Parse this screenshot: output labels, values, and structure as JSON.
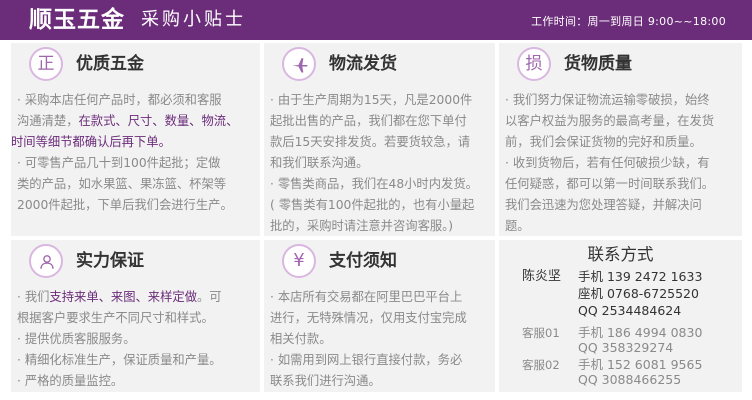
{
  "header": {
    "brand": "顺玉五金",
    "tagline": "采购小贴士",
    "hours": "工作时间：周一到周日  9:00~~18:00"
  },
  "colors": {
    "header_bg": "#6b2c7a",
    "highlight": "#6b2c7a",
    "panel_bg": "#f2f2f2",
    "icon_ring": "#d9b7e0"
  },
  "panels": {
    "quality_hardware": {
      "icon": "zheng-character-icon",
      "icon_char": "正",
      "title": "优质五金",
      "lines": [
        [
          "· 采购本店任何产品时，都必须和客服",
          "",
          ""
        ],
        [
          "沟通清楚，",
          "在款式、尺寸、数量、物流、",
          ""
        ],
        [
          "",
          "时间等细节都确认后再下单。",
          ""
        ],
        [
          "· 可零售产品几十到100件起批；定做",
          "",
          ""
        ],
        [
          "类的产品，如水果篮、果冻篮、杯架等",
          "",
          ""
        ],
        [
          "2000件起批，下单后我们会进行生产。",
          "",
          ""
        ]
      ]
    },
    "logistics": {
      "icon": "airplane-icon",
      "title": "物流发货",
      "lines": [
        "· 由于生产周期为15天，凡是2000件",
        "起批出售的产品，我们都在您下单付",
        "款后15天安排发货。若要货较急，请",
        "和我们联系沟通。",
        "· 零售类商品，我们在48小时内发货。",
        "( 零售类有100件起批的，也有小量起",
        "批的，采购时请注意并咨询客服。)"
      ]
    },
    "goods_quality": {
      "icon": "sun-character-icon",
      "icon_char": "损",
      "title": "货物质量",
      "lines": [
        "· 我们努力保证物流运输零破损，始终",
        "以客户权益为服务的最高考量，在发货",
        "前，我们会保证货物的完好和质量。",
        "· 收到货物后，若有任何破损少缺，有",
        "任何疑惑，都可以第一时间联系我们。",
        "我们会迅速为您处理答疑，并解决问",
        "题。"
      ]
    },
    "strength": {
      "icon": "person-icon",
      "title": "实力保证",
      "lines": [
        [
          "· 我们",
          "支持来单、来图、来样定做",
          "。可"
        ],
        [
          "根据客户要求生产不同尺寸和样式。",
          "",
          ""
        ],
        [
          "· 提供优质客服服务。",
          "",
          ""
        ],
        [
          "· 精细化标准生产，保证质量和产量。",
          "",
          ""
        ],
        [
          "· 严格的质量监控。",
          "",
          ""
        ]
      ]
    },
    "payment": {
      "icon": "yen-icon",
      "title": "支付须知",
      "lines": [
        "· 本店所有交易都在阿里巴巴平台上",
        "进行，无特殊情况，仅用支付宝完成",
        "相关付款。",
        "· 如需用到网上银行直接付款，务必",
        "联系我们进行沟通。"
      ]
    },
    "contact": {
      "title": "联系方式",
      "main_name": "陈炎坚",
      "main_mobile": "手机 139 2472 1633",
      "main_landline": "座机 0768-6725520",
      "main_qq": "QQ  2534484624",
      "cs1_name": "客服01",
      "cs1_mobile": "手机 186 4994 0830",
      "cs1_qq": "QQ  358329274",
      "cs2_name": "客服02",
      "cs2_mobile": "手机 152 6081 9565",
      "cs2_qq": "QQ  3088466255"
    }
  }
}
